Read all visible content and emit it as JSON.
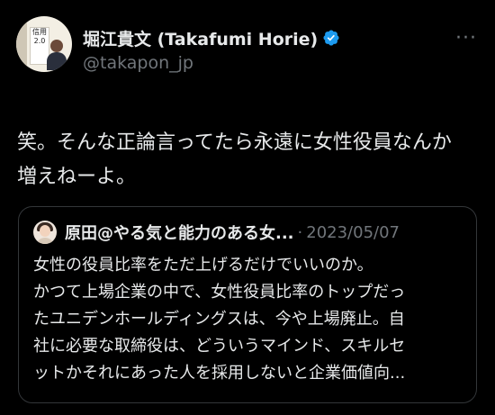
{
  "author": {
    "display_name": "堀江貴文 (Takafumi Horie)",
    "handle": "@takapon_jp",
    "verified": true,
    "avatar_book_text": "信用\n2.0"
  },
  "more_label": "···",
  "tweet": {
    "text": "笑。そんな正論言ってたら永遠に女性役員なんか\n増えねーよ。"
  },
  "quote": {
    "name": "原田@やる気と能力のある女...",
    "separator": "·",
    "date": "2023/05/07",
    "text": "女性の役員比率をただ上げるだけでいいのか。\nかつて上場企業の中で、女性役員比率のトップだっ\nたユニデンホールディングスは、今や上場廃止。自\n社に必要な取締役は、どういうマインド、スキルセ\nットかそれにあった人を採用しないと企業価値向..."
  },
  "colors": {
    "background": "#000000",
    "text_primary": "#e7e9ea",
    "text_secondary": "#71767b",
    "border": "#333639",
    "verified_blue": "#1d9bf0"
  },
  "icons": {
    "verified": "verified-badge-icon",
    "more": "more-options-icon"
  }
}
